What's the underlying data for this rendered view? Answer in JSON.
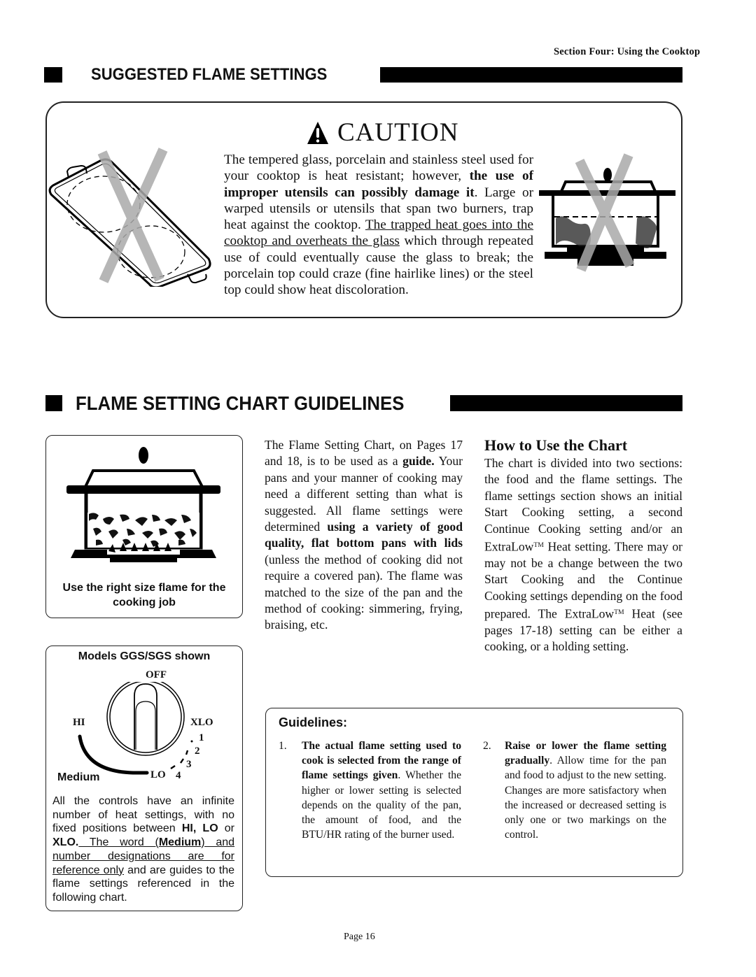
{
  "page": {
    "section_header": "Section Four: Using the Cooktop",
    "page_number": "Page 16"
  },
  "suggested": {
    "title": "SUGGESTED FLAME SETTINGS",
    "caution": {
      "title": "CAUTION",
      "icon": "warning-triangle-icon",
      "text_1": "The tempered glass, porcelain and stainless steel used for your cooktop is heat resistant; however, ",
      "text_bold": "the use of improper utensils can possibly damage it",
      "text_2": ". Large or warped utensils or utensils that span two burners, trap heat against the cooktop. ",
      "text_underline": "The trapped heat goes into the cooktop and overheats the glass",
      "text_3": " which through repeated use of could eventually cause the glass to break; the porcelain top could craze (fine hairlike lines) or the steel top could show heat discoloration."
    },
    "illustrations": {
      "left": "griddle-spanning-burners-crossed-out",
      "right": "oversized-pot-crossed-out"
    }
  },
  "guidelines_section": {
    "title": "FLAME SETTING CHART GUIDELINES",
    "pot_caption": "Use the right size flame for the cooking job",
    "dial": {
      "models_label": "Models GGS/SGS shown",
      "off": "OFF",
      "hi": "HI",
      "xlo": "XLO",
      "lo": "LO",
      "medium": "Medium",
      "marks": [
        "1",
        "2",
        "3",
        "4"
      ]
    },
    "controls_note": {
      "text_1": "All the controls have an infinite number of heat settings, with no fixed positions between ",
      "bold_1": "HI, LO",
      "text_2": " or ",
      "bold_2": "XLO.",
      "underline_1": " The word (",
      "underline_bold": "Medium",
      "underline_2": ") and number designations are for reference only",
      "text_3": " and are guides to the flame settings referenced in the following chart."
    },
    "middle_column": {
      "text_1": "The Flame Setting Chart, on Pages 17 and 18, is to be used as a ",
      "bold_1": "guide.",
      "text_2": " Your pans and your manner of cooking may need a different setting than what is suggested. All flame settings were determined ",
      "bold_2": "using a variety of good quality, flat bottom pans with lids",
      "text_3": " (unless the method of cooking did not require a covered pan). The flame was matched to the size of the pan and the method of cooking: simmering, frying, braising, etc."
    },
    "how_to": {
      "title": "How to Use the Chart",
      "text_1": "The chart is divided into two sections: the food and the flame settings. The flame settings section shows an initial Start Cooking setting, a second Continue Cooking setting and/or an ExtraLow",
      "tm": "TM",
      "text_2": " Heat setting. There may or may not be a change between the two Start Cooking and the Continue Cooking settings depending on the food prepared. The ExtraLow",
      "text_3": " Heat (see pages 17-18) setting can be either a cooking, or a holding setting."
    },
    "guidelines_box": {
      "title": "Guidelines:",
      "items": [
        {
          "num": "1.",
          "bold": "The actual flame setting used to cook is selected from the range of flame settings given",
          "text": ". Whether the higher or lower setting is selected depends on the quality of the pan, the amount of food, and the BTU/HR rating of the burner used."
        },
        {
          "num": "2.",
          "bold": "Raise or lower the flame setting gradually",
          "text": ". Allow time for the pan and food to adjust to the new setting. Changes are more satisfactory when the increased or decreased setting is only one or two markings on the control."
        }
      ]
    }
  }
}
